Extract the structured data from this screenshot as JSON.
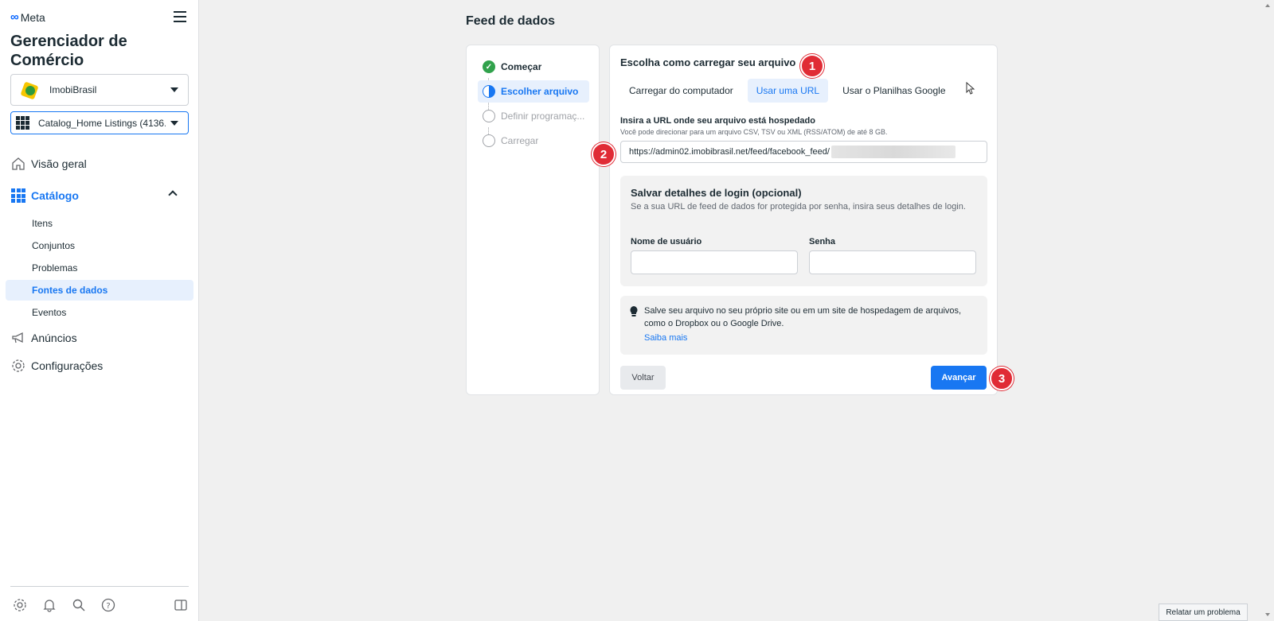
{
  "sidebar": {
    "brand": "Meta",
    "app_title": "Gerenciador de Comércio",
    "business_select": "ImobiBrasil",
    "catalog_select": "Catalog_Home Listings (4136...",
    "nav": {
      "overview": "Visão geral",
      "catalog": "Catálogo",
      "catalog_sub": [
        "Itens",
        "Conjuntos",
        "Problemas",
        "Fontes de dados",
        "Eventos"
      ],
      "ads": "Anúncios",
      "settings": "Configurações"
    },
    "footer_icons": [
      "gear-icon",
      "bell-icon",
      "search-icon",
      "help-icon",
      "panel-toggle-icon"
    ]
  },
  "main": {
    "page_title": "Feed de dados",
    "steps": [
      {
        "label": "Começar",
        "state": "done"
      },
      {
        "label": "Escolher arquivo",
        "state": "current"
      },
      {
        "label": "Definir programaç...",
        "state": "todo"
      },
      {
        "label": "Carregar",
        "state": "todo"
      }
    ],
    "form": {
      "heading": "Escolha como carregar seu arquivo",
      "tabs": [
        "Carregar do computador",
        "Usar uma URL",
        "Usar o Planilhas Google"
      ],
      "active_tab": "Usar uma URL",
      "url_label": "Insira a URL onde seu arquivo está hospedado",
      "url_help": "Você pode direcionar para um arquivo CSV, TSV ou XML (RSS/ATOM) de até 8 GB.",
      "url_value": "https://admin02.imobibrasil.net/feed/facebook_feed/",
      "login": {
        "title": "Salvar detalhes de login (opcional)",
        "description": "Se a sua URL de feed de dados for protegida por senha, insira seus detalhes de login.",
        "username_label": "Nome de usuário",
        "password_label": "Senha",
        "username_value": "",
        "password_value": ""
      },
      "tip": {
        "text": "Salve seu arquivo no seu próprio site ou em um site de hospedagem de arquivos, como o Dropbox ou o Google Drive.",
        "link": "Saiba mais"
      },
      "back_button": "Voltar",
      "next_button": "Avançar"
    },
    "markers": [
      "1",
      "2",
      "3"
    ]
  },
  "report_button": "Relatar um problema",
  "colors": {
    "accent": "#1877f2",
    "marker": "#e02b35",
    "success": "#31a24c",
    "background": "#f0f0f0"
  }
}
